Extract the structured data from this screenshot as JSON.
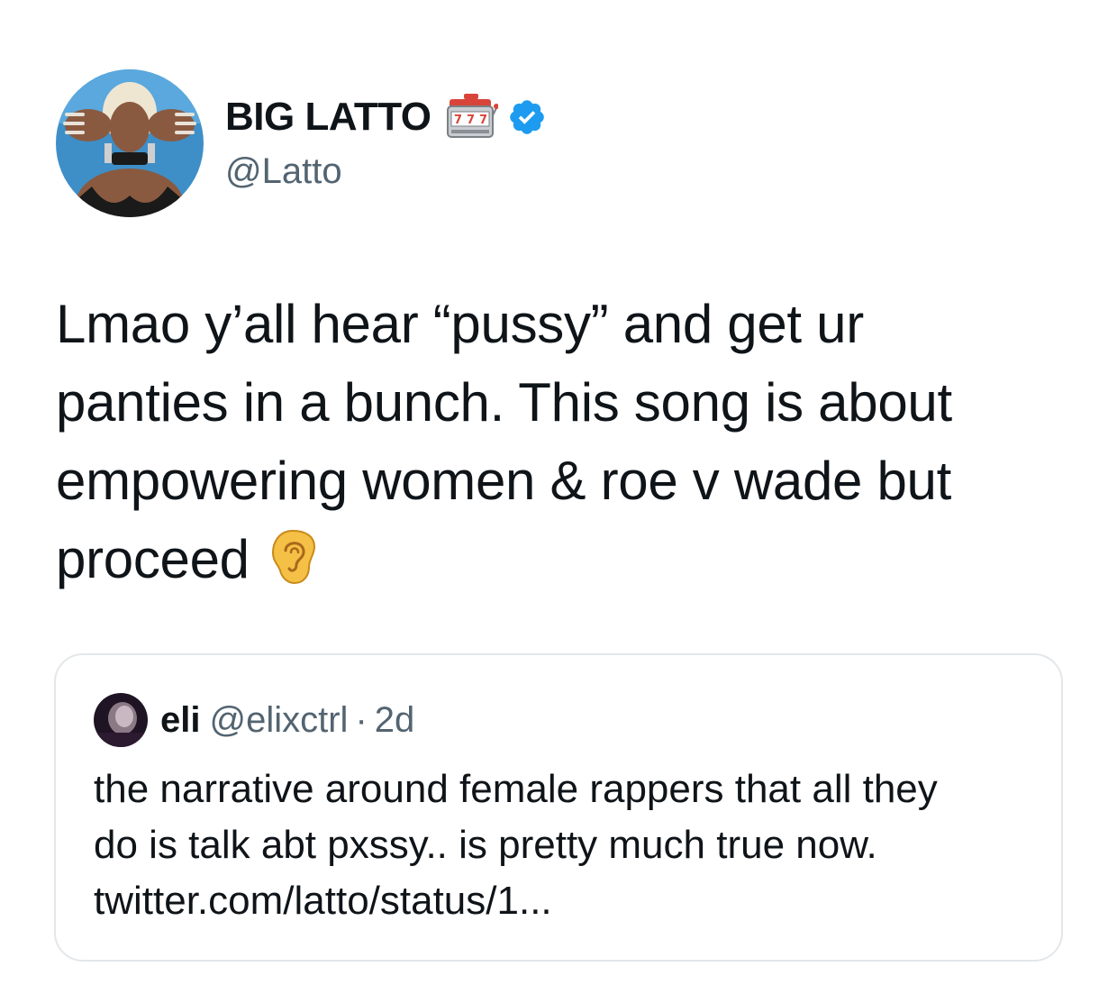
{
  "author": {
    "display_name": "BIG LATTO",
    "handle": "@Latto",
    "name_emoji": "slot-machine-icon",
    "verified": true,
    "verified_color": "#1d9bf0"
  },
  "tweet": {
    "lines": [
      "Lmao y’all hear “pussy” and get ur",
      "panties in a bunch. This song is about",
      "empowering women & roe v wade but",
      "proceed"
    ],
    "trailing_emoji": "ear-icon"
  },
  "quoted": {
    "name": "eli",
    "handle": "@elixctrl",
    "separator": "·",
    "time": "2d",
    "lines": [
      "the narrative around female rappers that all they",
      "do is talk abt pxssy.. is pretty much true now.",
      "twitter.com/latto/status/1..."
    ]
  },
  "colors": {
    "text_primary": "#0f1419",
    "text_secondary": "#536471",
    "card_border": "#e3e7ea"
  }
}
